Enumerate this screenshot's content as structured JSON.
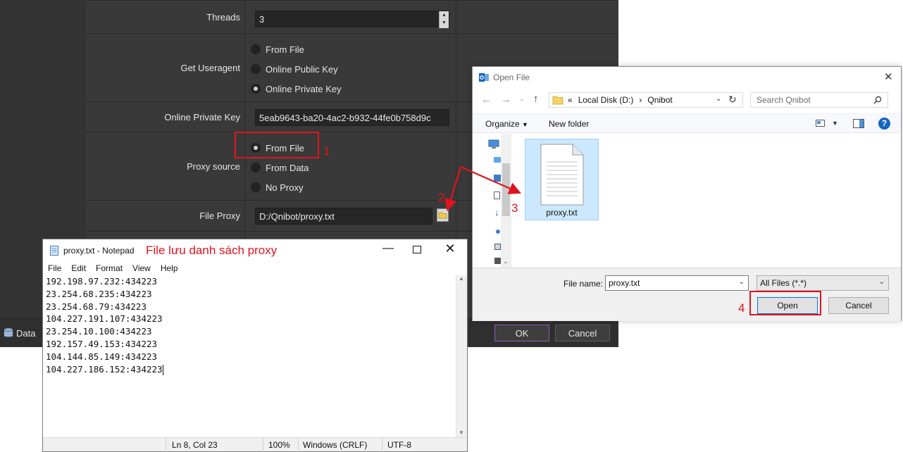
{
  "settings": {
    "threads": {
      "label": "Threads",
      "value": "3"
    },
    "useragent": {
      "label": "Get Useragent",
      "options": [
        {
          "label": "From File",
          "selected": false
        },
        {
          "label": "Online Public Key",
          "selected": false
        },
        {
          "label": "Online Private Key",
          "selected": true
        }
      ]
    },
    "private_key": {
      "label": "Online Private Key",
      "value": "5eab9643-ba20-4ac2-b932-44fe0b758d9c"
    },
    "proxy_source": {
      "label": "Proxy source",
      "options": [
        {
          "label": "From File",
          "selected": true
        },
        {
          "label": "From Data",
          "selected": false
        },
        {
          "label": "No Proxy",
          "selected": false
        }
      ]
    },
    "file_proxy": {
      "label": "File Proxy",
      "value": "D:/Qnibot/proxy.txt"
    }
  },
  "bottom_bar": {
    "data_tab": "Data",
    "ok": "OK",
    "cancel": "Cancel"
  },
  "annotations": {
    "step1": "1",
    "step2": "2",
    "step3": "3",
    "step4": "4",
    "notepad_caption": "File lưu danh sách proxy",
    "color": "#e0141e"
  },
  "notepad": {
    "title": "proxy.txt - Notepad",
    "menu": [
      "File",
      "Edit",
      "Format",
      "View",
      "Help"
    ],
    "lines": [
      "192.198.97.232:434223",
      "23.254.68.235:434223",
      "23.254.68.79:434223",
      "104.227.191.107:434223",
      "23.254.10.100:434223",
      "192.157.49.153:434223",
      "104.144.85.149:434223",
      "104.227.186.152:434223"
    ],
    "status": {
      "position": "Ln 8, Col 23",
      "zoom": "100%",
      "line_ending": "Windows (CRLF)",
      "encoding": "UTF-8"
    }
  },
  "open_file": {
    "title": "Open File",
    "address": {
      "prefix": "«",
      "drive": "Local Disk (D:)",
      "separator": "›",
      "folder": "Qnibot"
    },
    "search_placeholder": "Search Qnibot",
    "organize": "Organize",
    "new_folder": "New folder",
    "help": "?",
    "file_item": "proxy.txt",
    "file_name_label": "File name:",
    "file_name_value": "proxy.txt",
    "file_type": "All Files (*.*)",
    "open": "Open",
    "cancel": "Cancel"
  }
}
